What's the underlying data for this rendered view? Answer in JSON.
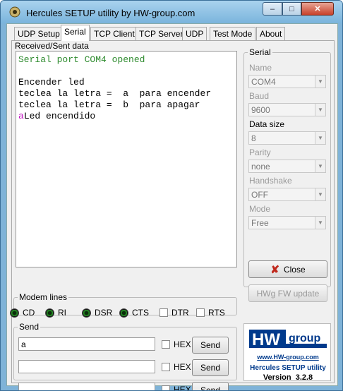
{
  "window": {
    "title": "Hercules SETUP utility by HW-group.com",
    "minimize": "–",
    "maximize": "□",
    "close": "✕"
  },
  "tabs": [
    {
      "label": "UDP Setup"
    },
    {
      "label": "Serial"
    },
    {
      "label": "TCP Client"
    },
    {
      "label": "TCP Server"
    },
    {
      "label": "UDP"
    },
    {
      "label": "Test Mode"
    },
    {
      "label": "About"
    }
  ],
  "active_tab": "Serial",
  "received": {
    "label": "Received/Sent data",
    "status": "Serial port COM4 opened",
    "lines": [
      "Encender led",
      "teclea la letra =  a  para encender",
      "teclea la letra =  b  para apagar"
    ],
    "echo_char": "a",
    "last_line": "Led encendido"
  },
  "serial": {
    "legend": "Serial",
    "name_label": "Name",
    "name_value": "COM4",
    "baud_label": "Baud",
    "baud_value": "9600",
    "datasize_label": "Data size",
    "datasize_value": "8",
    "parity_label": "Parity",
    "parity_value": "none",
    "handshake_label": "Handshake",
    "handshake_value": "OFF",
    "mode_label": "Mode",
    "mode_value": "Free",
    "close_label": "Close",
    "hwfw_label": "HWg FW update"
  },
  "modem": {
    "legend": "Modem lines",
    "leds": [
      {
        "label": "CD"
      },
      {
        "label": "RI"
      },
      {
        "label": "DSR"
      },
      {
        "label": "CTS"
      }
    ],
    "checks": [
      {
        "label": "DTR"
      },
      {
        "label": "RTS"
      }
    ]
  },
  "send": {
    "legend": "Send",
    "rows": [
      {
        "value": "a",
        "hex_label": "HEX",
        "button": "Send"
      },
      {
        "value": "",
        "hex_label": "HEX",
        "button": "Send"
      },
      {
        "value": "",
        "hex_label": "HEX",
        "button": "Send"
      }
    ]
  },
  "logo": {
    "hw": "HW",
    "group": "group",
    "url": "www.HW-group.com",
    "name": "Hercules SETUP utility",
    "version_label": "Version",
    "version": "3.2.8"
  },
  "colors": {
    "status_text": "#2e8b2e",
    "echo_text": "#c010c0",
    "brand_blue": "#003a8c",
    "close_x": "#c0281c"
  }
}
